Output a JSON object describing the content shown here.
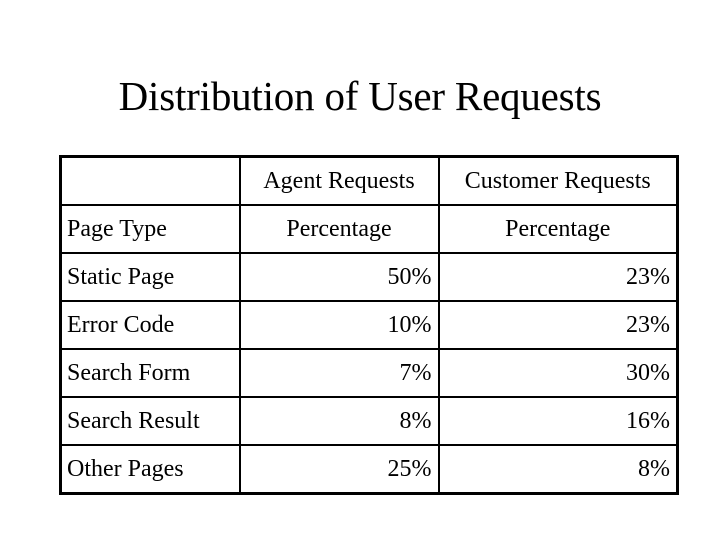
{
  "title": "Distribution of User Requests",
  "table": {
    "header_row1": [
      "",
      "Agent Requests",
      "Customer Requests"
    ],
    "header_row2": [
      "Page Type",
      "Percentage",
      "Percentage"
    ],
    "rows": [
      {
        "page_type": "Static Page",
        "agent": "50%",
        "customer": "23%"
      },
      {
        "page_type": "Error Code",
        "agent": "10%",
        "customer": "23%"
      },
      {
        "page_type": "Search Form",
        "agent": "7%",
        "customer": "30%"
      },
      {
        "page_type": "Search Result",
        "agent": "8%",
        "customer": "16%"
      },
      {
        "page_type": "Other Pages",
        "agent": "25%",
        "customer": "8%"
      }
    ]
  }
}
